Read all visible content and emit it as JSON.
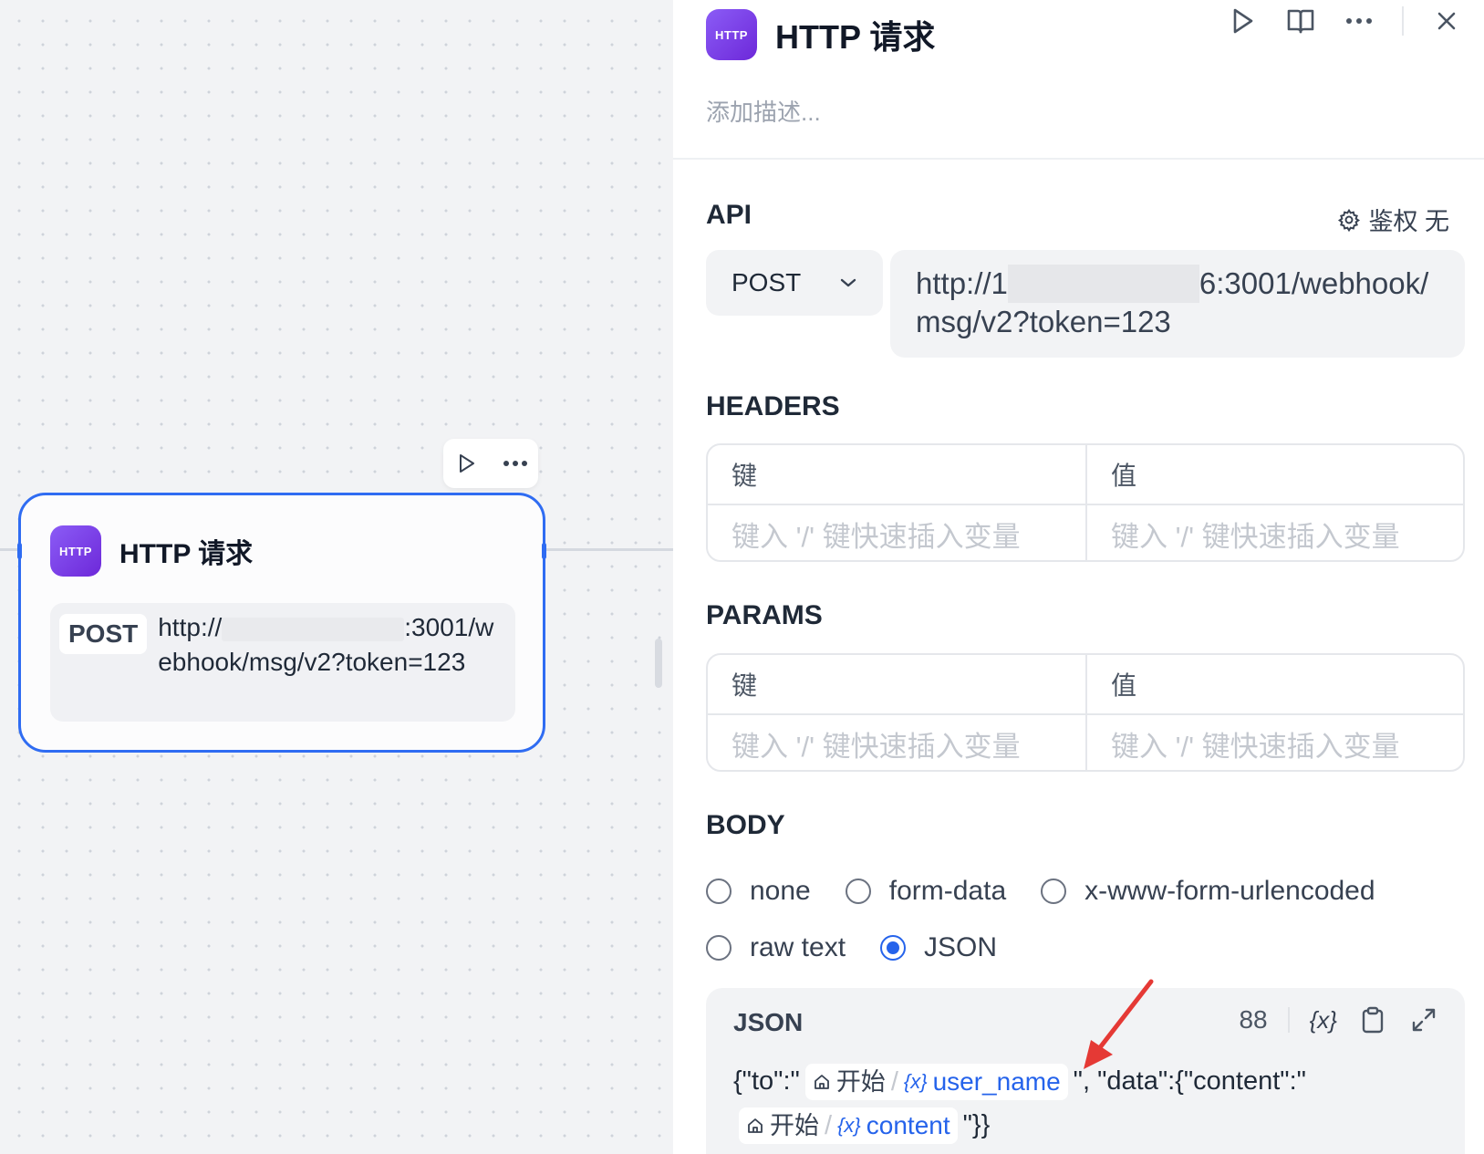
{
  "canvas": {
    "node": {
      "badge": "HTTP",
      "title": "HTTP 请求",
      "method": "POST",
      "url_prefix": "http://",
      "url_suffix": ":3001/webhook/msg/v2?token=123"
    }
  },
  "panel": {
    "badge": "HTTP",
    "title": "HTTP 请求",
    "description_placeholder": "添加描述...",
    "api_label": "API",
    "auth_label": "鉴权 无",
    "method": "POST",
    "url_prefix": "http://1",
    "url_suffix": "6:3001/webhook/msg/v2?token=123",
    "headers": {
      "label": "HEADERS",
      "key_header": "键",
      "value_header": "值",
      "key_placeholder": "键入 '/' 键快速插入变量",
      "value_placeholder": "键入 '/' 键快速插入变量"
    },
    "params": {
      "label": "PARAMS",
      "key_header": "键",
      "value_header": "值",
      "key_placeholder": "键入 '/' 键快速插入变量",
      "value_placeholder": "键入 '/' 键快速插入变量"
    },
    "body": {
      "label": "BODY",
      "options": [
        "none",
        "form-data",
        "x-www-form-urlencoded",
        "raw text",
        "JSON"
      ],
      "selected": "JSON"
    },
    "json": {
      "label": "JSON",
      "count": "88",
      "var_tool": "{x}",
      "part1": "{\"to\":\"",
      "chip1_source": "开始",
      "chip1_var": "user_name",
      "part2": "\", \"data\":{\"content\":\"",
      "chip2_source": "开始",
      "chip2_var": "content",
      "part3": "\"}}"
    },
    "annotation_color": "#e53935",
    "accent_color": "#2563eb",
    "badge_color": "#7c3aed"
  }
}
